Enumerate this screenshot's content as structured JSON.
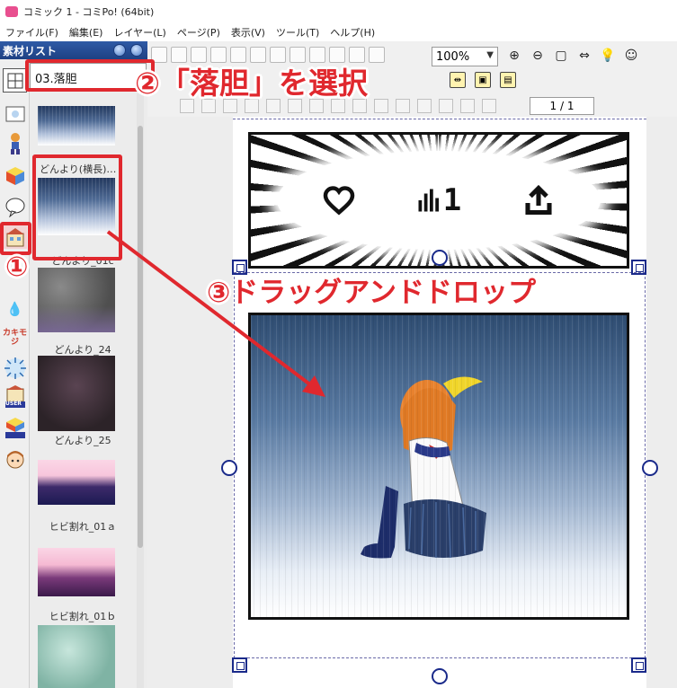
{
  "window": {
    "title": "コミック 1 - コミPo! (64bit)"
  },
  "menu": [
    "ファイル(F)",
    "編集(E)",
    "レイヤー(L)",
    "ページ(P)",
    "表示(V)",
    "ツール(T)",
    "ヘルプ(H)"
  ],
  "panel": {
    "title": "素材リスト",
    "category": "03.落胆",
    "icon_tabs": [
      "layout-icon",
      "background-icon",
      "character-icon",
      "3d-cube-icon",
      "speech-bubble-icon",
      "building-icon",
      "effect-icon",
      "kakimoji-icon",
      "burst-icon",
      "user-icon",
      "3d-user-icon",
      "face-icon"
    ],
    "kakimoji_label": "カキモジ",
    "user_label": "USER",
    "items": [
      {
        "label": "",
        "style": "blue"
      },
      {
        "label": "どんより(横長)…",
        "style": "blue",
        "selected": true
      },
      {
        "label": "どんより_01c",
        "style": "blue"
      },
      {
        "label": "どんより_24",
        "style": "gray"
      },
      {
        "label": "どんより_25",
        "style": "dark"
      },
      {
        "label": "ヒビ割れ_01ａ",
        "style": "crack"
      },
      {
        "label": "ヒビ割れ_01ｂ",
        "style": "crack2"
      },
      {
        "label": "",
        "style": "teal"
      }
    ]
  },
  "toolbar": {
    "zoom": "100%",
    "page": "1 / 1"
  },
  "canvas": {
    "panel1_counts": {
      "likes": "",
      "views": "1",
      "share": ""
    }
  },
  "annotations": {
    "step1": "①",
    "step2": "②「落胆」を選択",
    "step3": "③ドラッグアンドドロップ",
    "color": "#e0282e"
  }
}
